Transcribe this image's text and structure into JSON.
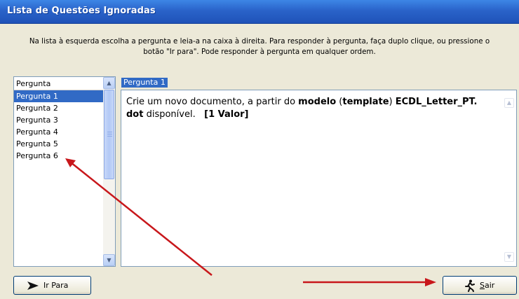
{
  "window": {
    "title": "Lista de Questões Ignoradas"
  },
  "instructions": {
    "line1": "Na lista à esquerda escolha a pergunta e leia-a na caixa à direita. Para responder à pergunta, faça duplo clique, ou pressione o",
    "line2": "botão \"Ir para\". Pode responder à pergunta em qualquer ordem."
  },
  "list": {
    "header": "Pergunta",
    "items": [
      "Pergunta 1",
      "Pergunta 2",
      "Pergunta 3",
      "Pergunta 4",
      "Pergunta 5",
      "Pergunta 6"
    ],
    "selected_index": 0
  },
  "question": {
    "label": "Pergunta 1",
    "text_part1": "Crie um novo documento, a partir do ",
    "bold1": "modelo",
    "text_part2": " (",
    "bold2": "template",
    "text_part3": ") ",
    "bold3": "ECDL_Letter_PT.",
    "line2_bold": "dot",
    "line2_text": " disponível.",
    "value_label": "[1 Valor]"
  },
  "buttons": {
    "go_to": "Ir Para",
    "exit": "Sair"
  },
  "icons": {
    "go_to_icon": "arrow-right-icon",
    "exit_icon": "running-man-icon"
  },
  "colors": {
    "titlebar": "#2a63c9",
    "selection": "#316ac5",
    "annotation_arrows": "#c8171b"
  }
}
